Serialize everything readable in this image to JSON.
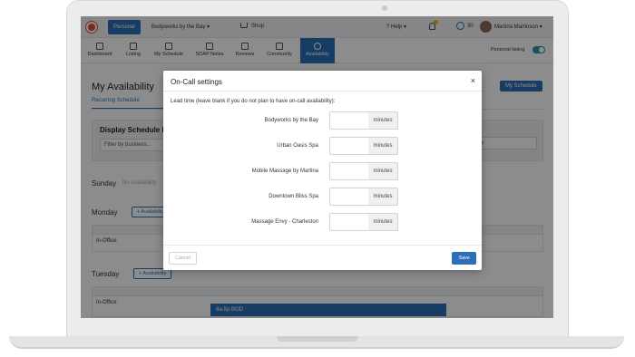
{
  "topbar": {
    "personal_label": "Personal",
    "business": "Bodyworks by the Bay",
    "shop": "Shop",
    "help": "Help",
    "notif_count": "1",
    "points": "30",
    "user": "Martina Martinson"
  },
  "nav": {
    "items": [
      {
        "label": "Dashboard",
        "icon": "dashboard-icon"
      },
      {
        "label": "Listing",
        "icon": "listing-icon"
      },
      {
        "label": "My Schedule",
        "icon": "calendar-icon"
      },
      {
        "label": "SOAP Notes",
        "icon": "person-icon"
      },
      {
        "label": "Reviews",
        "icon": "star-icon"
      },
      {
        "label": "Community",
        "icon": "chat-icon"
      },
      {
        "label": "Availability",
        "icon": "clock-icon"
      }
    ],
    "personal_listing_label": "Personal listing"
  },
  "page": {
    "title": "My Availability",
    "my_schedule_button": "My Schedule",
    "tab": "Recurring Schedule",
    "display_title": "Display Schedule F",
    "filter_placeholder": "Filter by business...",
    "filter2_value": "gs",
    "sunday": "Sunday",
    "sunday_note": "No Availability",
    "monday": "Monday",
    "tuesday": "Tuesday",
    "availability_button": "+ Availability",
    "in_office": "In-Office",
    "tuesday_slot": "8a-5p BOD"
  },
  "modal": {
    "title": "On-Call settings",
    "close": "×",
    "lead_text": "Lead time (leave blank if you do not plan to have on-call availability):",
    "rows": [
      {
        "label": "Bodyworks by the Bay",
        "value": "",
        "unit": "minutes"
      },
      {
        "label": "Urban Oasis Spa",
        "value": "",
        "unit": "minutes"
      },
      {
        "label": "Mobile Massage by Martina",
        "value": "",
        "unit": "minutes"
      },
      {
        "label": "Downtown Bliss Spa",
        "value": "",
        "unit": "minutes"
      },
      {
        "label": "Massage Envy - Charleston",
        "value": "",
        "unit": "minutes"
      }
    ],
    "cancel": "Cancel",
    "save": "Save"
  },
  "colors": {
    "primary": "#2d6fb6",
    "toggle": "#1e9aa8",
    "logo": "#e04a3a"
  }
}
